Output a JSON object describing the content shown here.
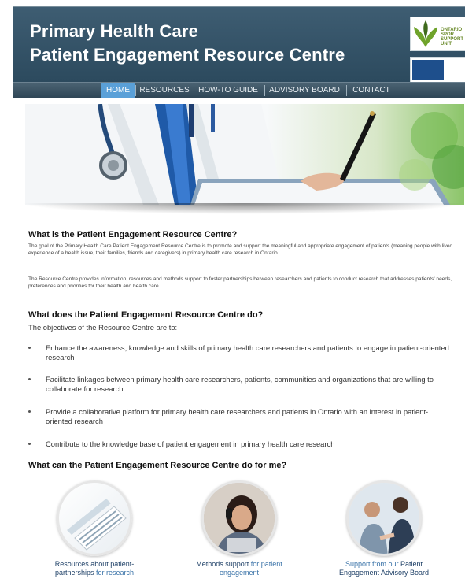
{
  "header": {
    "title_line1": "Primary Health Care",
    "title_line2": "Patient Engagement Resource Centre",
    "logo_ontario_text": "ONTARIO\nSPOR SUPPORT\nUNIT"
  },
  "nav": {
    "items": [
      {
        "label": "HOME"
      },
      {
        "label": "RESOURCES"
      },
      {
        "label": "HOW-TO GUIDE"
      },
      {
        "label": "ADVISORY BOARD"
      },
      {
        "label": "CONTACT"
      }
    ]
  },
  "section1": {
    "title": "What is the Patient Engagement Resource Centre?",
    "p1": "The goal of the Primary Health Care Patient Engagement Resource Centre is to promote and support the meaningful and appropriate engagement of patients (meaning people with lived experience of a health issue, their families, friends and caregivers) in primary health care research in Ontario.",
    "p2": "The Resource Centre provides information, resources and methods support to foster partnerships between researchers and patients to conduct research that addresses patients' needs, preferences and priorities for their health and health care."
  },
  "section2": {
    "title": "What does the Patient Engagement Resource Centre do?",
    "intro": "The objectives of the Resource Centre are to:",
    "bullets": [
      "Enhance the awareness, knowledge and skills of primary health care researchers and patients to engage in patient-oriented research",
      "Facilitate linkages between primary health care researchers, patients, communities and organizations that are willing to collaborate for research",
      "Provide a collaborative platform for primary health care researchers and patients in Ontario with an interest in patient-oriented research",
      "Contribute to the knowledge base of patient engagement in primary health care research"
    ]
  },
  "section3": {
    "title": "What can the Patient Engagement Resource Centre do for me?",
    "cards": [
      {
        "strong": "Resources about patient-partnerships",
        "rest": " for research"
      },
      {
        "strong": "Methods support",
        "rest": " for patient engagement"
      },
      {
        "pre": "Support from our ",
        "strong": "Patient Engagement Advisory Board"
      }
    ]
  },
  "colors": {
    "header_bg": "#34546a",
    "nav_active": "#5aa0d8",
    "link_dark": "#1d3f66"
  }
}
